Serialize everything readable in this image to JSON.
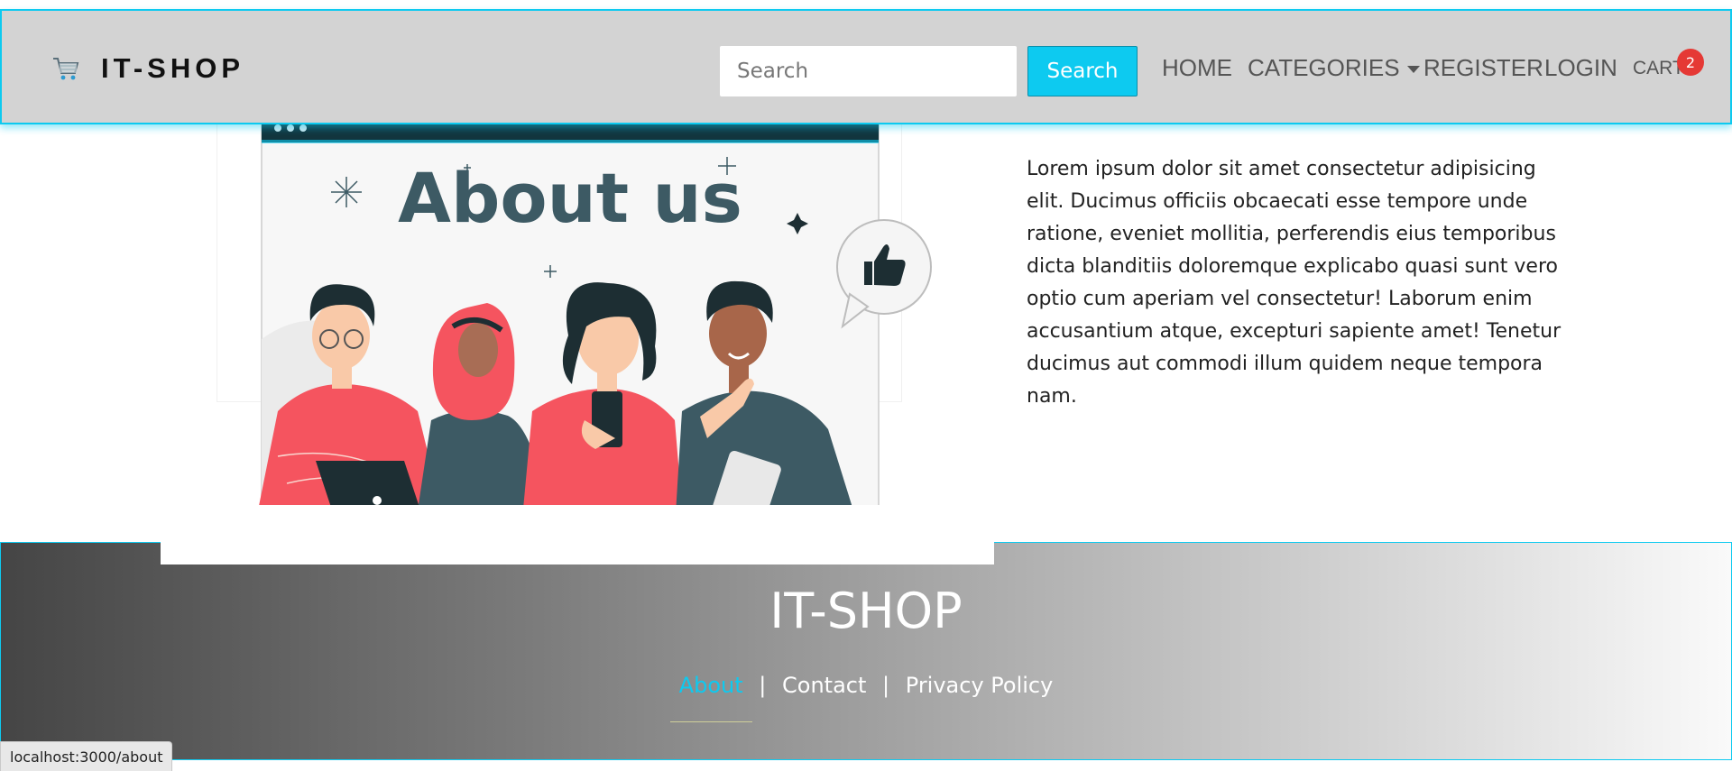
{
  "navbar": {
    "brand": "IT-SHOP",
    "search": {
      "placeholder": "Search",
      "value": ""
    },
    "search_button": "Search",
    "links": {
      "home": "HOME",
      "categories": "CATEGORIES",
      "register": "REGISTER",
      "login": "LOGIN",
      "cart": "CART"
    },
    "cart_count": "2"
  },
  "main": {
    "illustration_title": "About us",
    "about_paragraph": "Lorem ipsum dolor sit amet consectetur adipisicing elit. Ducimus officiis obcaecati esse tempore unde ratione, eveniet mollitia, perferendis eius temporibus dicta blanditiis doloremque explicabo quasi sunt vero optio cum aperiam vel consectetur! Laborum enim accusantium atque, excepturi sapiente amet! Tenetur ducimus aut commodi illum quidem neque tempora nam."
  },
  "footer": {
    "title": "IT-SHOP",
    "links": {
      "about": "About",
      "contact": "Contact",
      "privacy": "Privacy Policy"
    },
    "separator": "|"
  },
  "status_bar": {
    "url": "localhost:3000/about"
  },
  "colors": {
    "accent": "#0dcaf0",
    "navbar_bg": "#d3d3d3",
    "badge": "#e53935",
    "illustration_coral": "#f5545f",
    "illustration_slate": "#3d5a64"
  }
}
